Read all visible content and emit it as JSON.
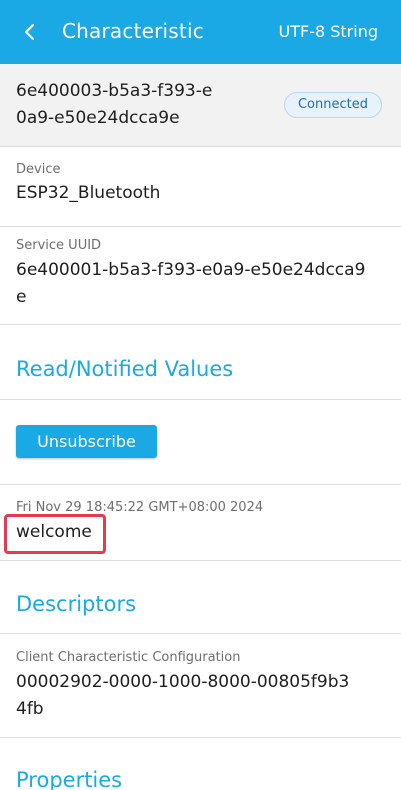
{
  "header": {
    "title": "Characteristic",
    "format": "UTF-8 String"
  },
  "characteristic": {
    "uuid_line1": "6e400003-b5a3-f393-e",
    "uuid_line2": "0a9-e50e24dcca9e",
    "status": "Connected"
  },
  "device": {
    "label": "Device",
    "value": "ESP32_Bluetooth"
  },
  "service": {
    "label": "Service UUID",
    "value_line1": "6e400001-b5a3-f393-e0a9-e50e24dcca9",
    "value_line2": "e"
  },
  "values_section": {
    "title": "Read/Notified Values",
    "unsubscribe_label": "Unsubscribe",
    "timestamp": "Fri Nov 29 18:45:22 GMT+08:00 2024",
    "value": "welcome"
  },
  "descriptors_section": {
    "title": "Descriptors",
    "label": "Client Characteristic Configuration",
    "value_line1": "00002902-0000-1000-8000-00805f9b3",
    "value_line2": "4fb"
  },
  "properties_section": {
    "title": "Properties"
  },
  "colors": {
    "accent": "#1ba9e6",
    "highlight": "#e23b55",
    "badge_text": "#1e6fb3"
  }
}
